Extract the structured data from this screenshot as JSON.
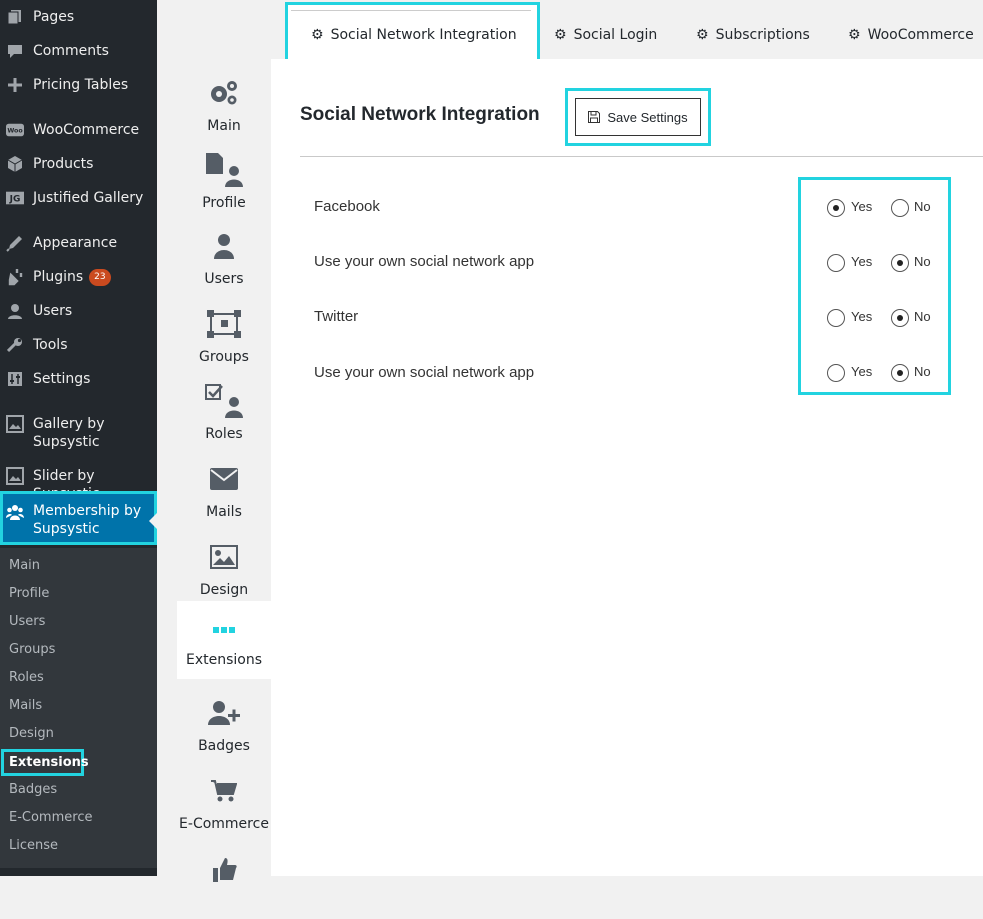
{
  "sidebar": {
    "items": [
      {
        "label": "Pages",
        "icon": "pages-icon"
      },
      {
        "label": "Comments",
        "icon": "comments-icon"
      },
      {
        "label": "Pricing Tables",
        "icon": "plus-icon"
      },
      {
        "label": "WooCommerce",
        "icon": "woocommerce-icon"
      },
      {
        "label": "Products",
        "icon": "products-icon"
      },
      {
        "label": "Justified Gallery",
        "icon": "jg-icon"
      },
      {
        "label": "Appearance",
        "icon": "appearance-icon"
      },
      {
        "label": "Plugins",
        "icon": "plugins-icon",
        "badge": "23"
      },
      {
        "label": "Users",
        "icon": "users-icon"
      },
      {
        "label": "Tools",
        "icon": "tools-icon"
      },
      {
        "label": "Settings",
        "icon": "settings-icon"
      },
      {
        "label": "Gallery by Supsystic",
        "icon": "gallery-icon"
      },
      {
        "label": "Slider by Supsystic",
        "icon": "slider-icon"
      },
      {
        "label": "Membership by Supsystic",
        "icon": "membership-icon"
      }
    ],
    "submenu": [
      "Main",
      "Profile",
      "Users",
      "Groups",
      "Roles",
      "Mails",
      "Design",
      "Extensions",
      "Badges",
      "E-Commerce",
      "License"
    ],
    "current_submenu": "Extensions"
  },
  "tabs": [
    "Social Network Integration",
    "Social Login",
    "Subscriptions",
    "WooCommerce"
  ],
  "active_tab": "Social Network Integration",
  "leftnav": [
    "Main",
    "Profile",
    "Users",
    "Groups",
    "Roles",
    "Mails",
    "Design",
    "Extensions",
    "Badges",
    "E-Commerce"
  ],
  "active_leftnav": "Extensions",
  "content": {
    "heading": "Social Network Integration",
    "save_label": "Save Settings",
    "yes_label": "Yes",
    "no_label": "No",
    "options": [
      {
        "label": "Facebook",
        "value": "Yes"
      },
      {
        "label": "Use your own social network app",
        "value": "No"
      },
      {
        "label": "Twitter",
        "value": "No"
      },
      {
        "label": "Use your own social network app",
        "value": "No"
      }
    ]
  },
  "colors": {
    "highlight": "#22d3e0",
    "admin_bg": "#23282d",
    "active_menu": "#0073aa",
    "badge": "#ca4a1f"
  }
}
